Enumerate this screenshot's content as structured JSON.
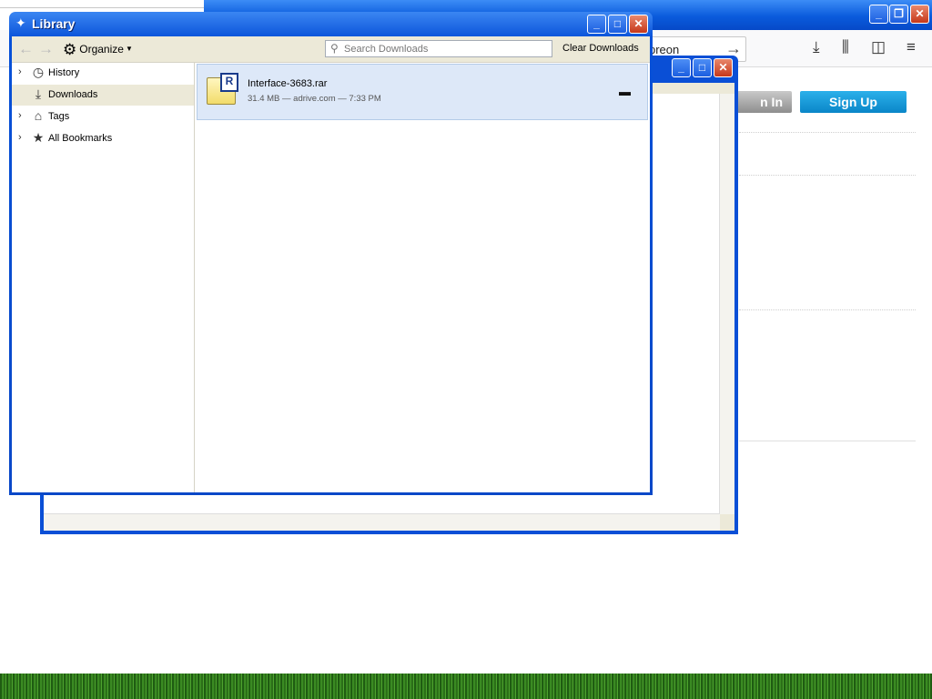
{
  "background_browser": {
    "url_text": "preon",
    "signin_label": "n In",
    "signup_label": "Sign Up"
  },
  "library": {
    "title": "Library",
    "toolbar": {
      "organize_label": "Organize",
      "search_placeholder": "Search Downloads",
      "clear_label": "Clear Downloads"
    },
    "sidebar": {
      "items": [
        {
          "label": "History",
          "icon": "clock-icon"
        },
        {
          "label": "Downloads",
          "icon": "download-icon"
        },
        {
          "label": "Tags",
          "icon": "tag-icon"
        },
        {
          "label": "All Bookmarks",
          "icon": "star-icon"
        }
      ]
    },
    "downloads": [
      {
        "name": "Interface-3683.rar",
        "meta": "31.4 MB — adrive.com — 7:33 PM",
        "icon_letter": "R"
      }
    ]
  }
}
